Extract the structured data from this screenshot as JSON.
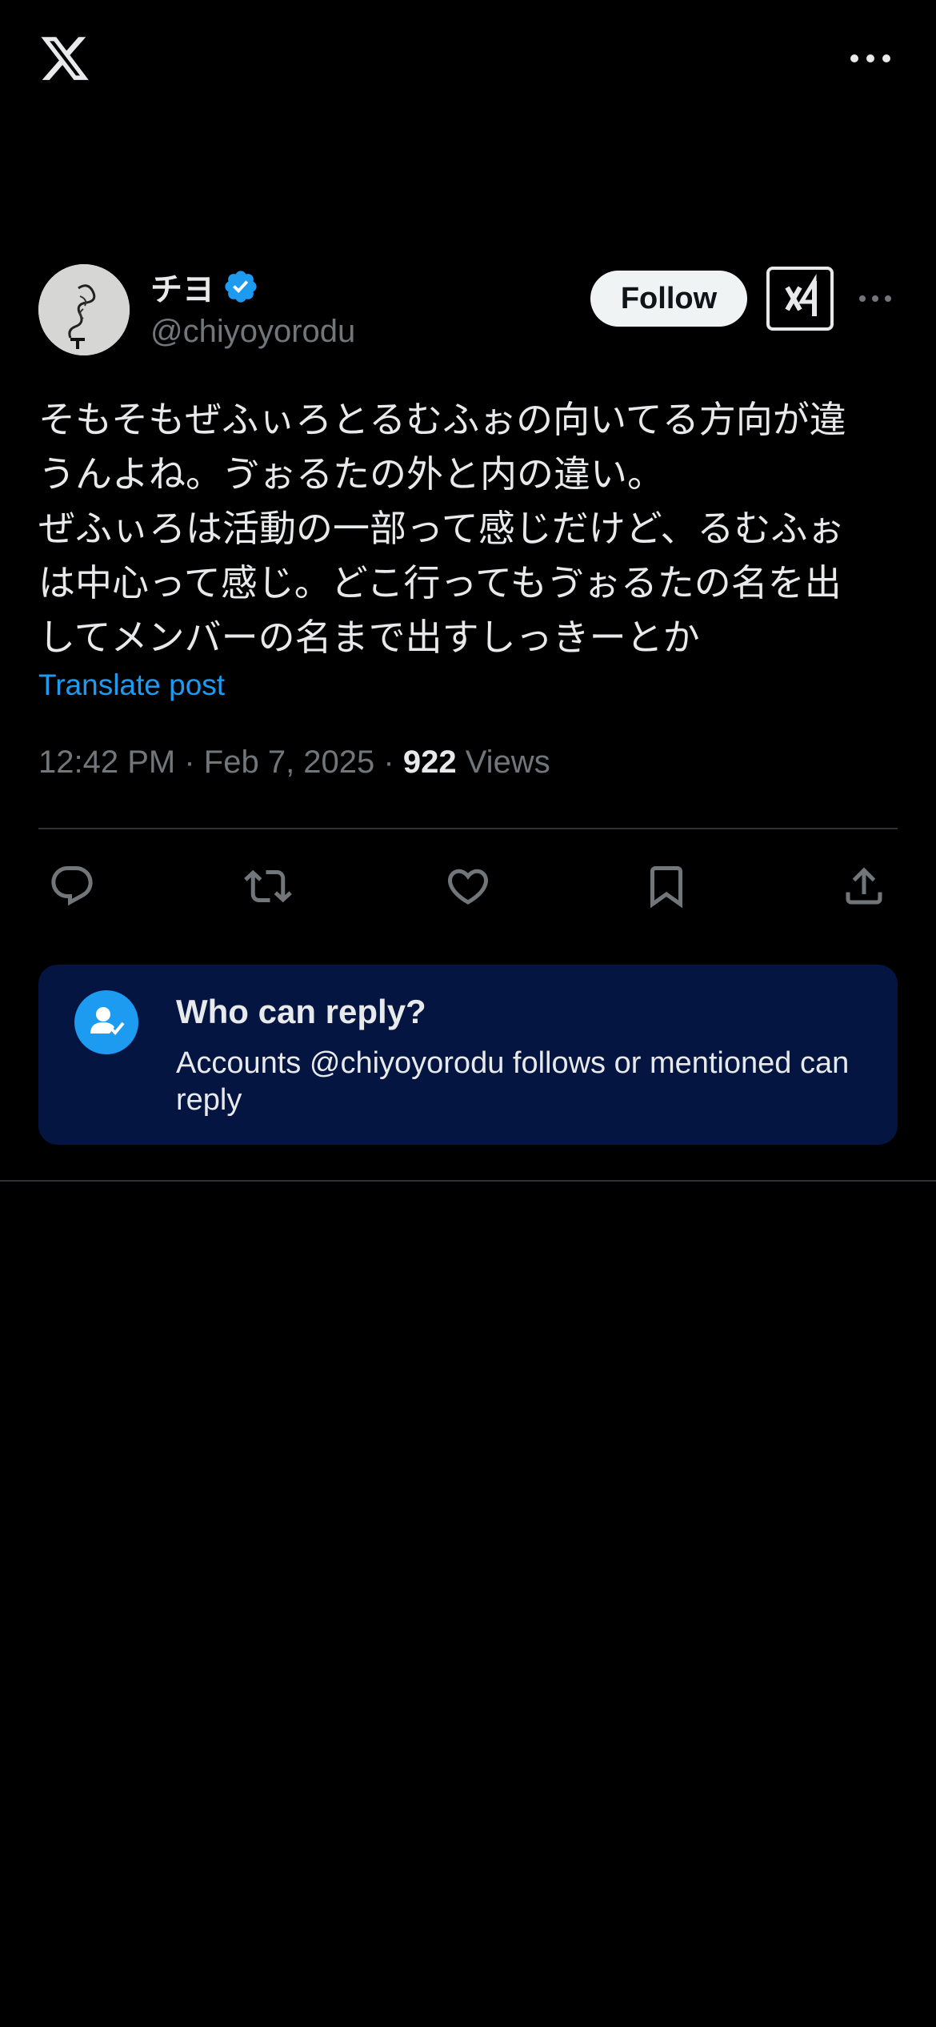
{
  "header": {
    "logo_icon": "x-logo-icon",
    "more_icon": "more-horizontal-icon"
  },
  "tweet": {
    "display_name": "チヨ",
    "handle": "@chiyoyorodu",
    "verified": true,
    "follow_label": "Follow",
    "text": "そもそもぜふぃろとるむふぉの向いてる方向が違\nうんよね。ゔぉるたの外と内の違い。\nぜふぃろは活動の一部って感じだけど、るむふぉ\nは中心って感じ。どこ行ってもゔぉるたの名を出\nしてメンバーの名まで出すしっきーとか",
    "translate_label": "Translate post",
    "time": "12:42 PM",
    "date": "Feb 7, 2025",
    "views_count": "922",
    "views_label": "Views"
  },
  "actions": [
    "reply-icon",
    "repost-icon",
    "like-icon",
    "bookmark-icon",
    "share-icon"
  ],
  "reply_restriction": {
    "title": "Who can reply?",
    "description": "Accounts @chiyoyorodu follows or mentioned can reply"
  },
  "colors": {
    "accent": "#1d9bf0",
    "background": "#000000",
    "card": "#031540",
    "muted": "#71767b"
  }
}
